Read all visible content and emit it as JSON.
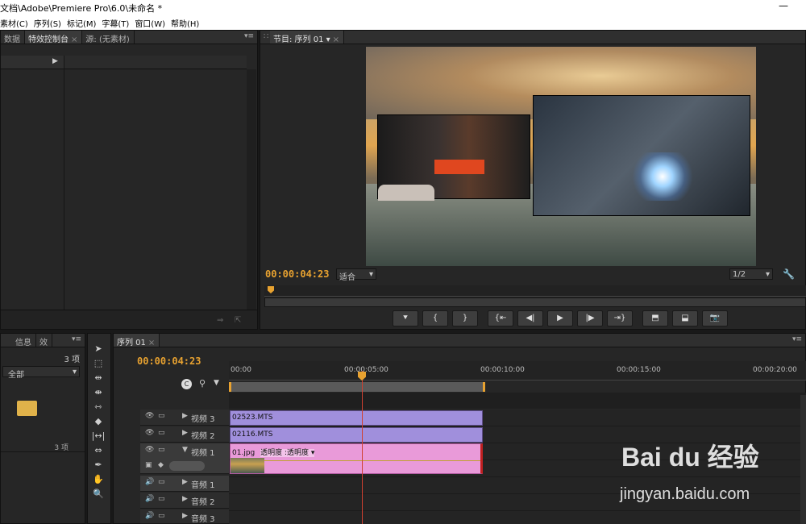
{
  "window": {
    "title": "文档\\Adobe\\Premiere Pro\\6.0\\未命名 *",
    "close_glyph": "—"
  },
  "menu": [
    "素材(C)",
    "序列(S)",
    "标记(M)",
    "字幕(T)",
    "窗口(W)",
    "帮助(H)"
  ],
  "effect_controls": {
    "tabs": [
      "数据",
      "特效控制台",
      "源: (无素材)"
    ],
    "active": 1
  },
  "program_monitor": {
    "tab": "节目: 序列 01",
    "timecode": "00:00:04:23",
    "fit": "适合",
    "resolution": "1/2"
  },
  "transport": {
    "buttons": [
      "marker",
      "in",
      "out",
      "go-in",
      "step-back",
      "play",
      "step-forward",
      "go-out",
      "lift",
      "extract",
      "export-frame"
    ]
  },
  "project": {
    "tabs": [
      "信息",
      "效"
    ],
    "count_label": "3 项",
    "filter": "全部",
    "footer_count": "3 项"
  },
  "timeline": {
    "tab": "序列 01",
    "timecode": "00:00:04:23",
    "ruler": [
      "00:00",
      "00:00:05:00",
      "00:00:10:00",
      "00:00:15:00",
      "00:00:20:00"
    ],
    "playhead_fraction": 0.24,
    "tracks": [
      {
        "name": "视频 3",
        "clip": "02523.MTS"
      },
      {
        "name": "视频 2",
        "clip": "02116.MTS"
      },
      {
        "name": "视频 1",
        "clip": "01.jpg",
        "effect": "透明度 :透明度"
      },
      {
        "name": "音频 1"
      },
      {
        "name": "音频 2"
      },
      {
        "name": "音频 3"
      }
    ]
  },
  "watermark": {
    "brand": "Bai du 经验",
    "url": "jingyan.baidu.com"
  },
  "colors": {
    "accent": "#e8a230",
    "clip_purple": "#a08fdc",
    "clip_pink": "#e99ad9",
    "playhead": "#d04030"
  }
}
